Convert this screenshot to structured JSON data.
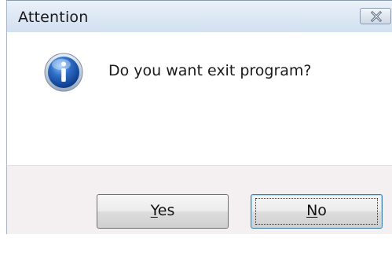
{
  "window": {
    "title": "Attention",
    "close_icon": "close-icon"
  },
  "message": {
    "icon": "info-icon",
    "text": "Do you want exit program?"
  },
  "buttons": {
    "yes": {
      "mnemonic": "Y",
      "rest": "es"
    },
    "no": {
      "mnemonic": "N",
      "rest": "o"
    }
  },
  "colors": {
    "titlebar_top": "#eaf1f9",
    "titlebar_bottom": "#d2e0f0",
    "button_area_bg": "#f4eff1",
    "info_icon_blue": "#2e6fc7"
  }
}
